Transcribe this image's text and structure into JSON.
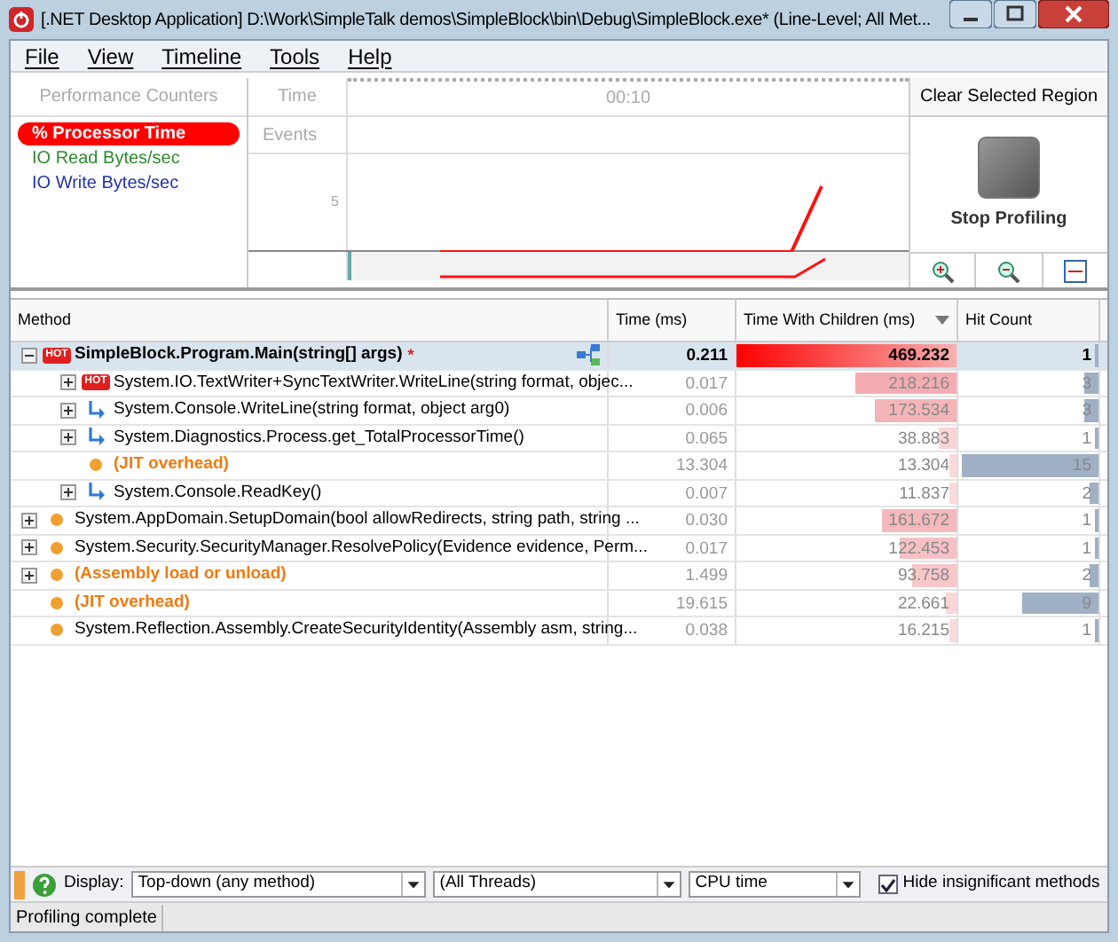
{
  "window": {
    "title": "[.NET Desktop Application] D:\\Work\\SimpleTalk demos\\SimpleBlock\\bin\\Debug\\SimpleBlock.exe* (Line-Level; All Met..."
  },
  "menu": [
    "File",
    "View",
    "Timeline",
    "Tools",
    "Help"
  ],
  "counters": {
    "title": "Performance Counters",
    "items": [
      {
        "label": "% Processor Time",
        "selected": true,
        "color": "#ff0000"
      },
      {
        "label": "IO Read Bytes/sec",
        "selected": false,
        "color": "#2e8b2e"
      },
      {
        "label": "IO Write Bytes/sec",
        "selected": false,
        "color": "#2233aa"
      }
    ]
  },
  "timeline": {
    "time_label": "Time",
    "time_tick": "00:10",
    "events_label": "Events",
    "axis_tick": "5"
  },
  "right_panel": {
    "clear_button": "Clear Selected Region",
    "stop_button": "Stop Profiling"
  },
  "table": {
    "columns": [
      {
        "label": "Method",
        "sorted": false
      },
      {
        "label": "Time (ms)",
        "sorted": false
      },
      {
        "label": "Time With Children (ms)",
        "sorted": true
      },
      {
        "label": "Hit Count",
        "sorted": false
      }
    ],
    "rows": [
      {
        "method": "SimpleBlock.Program.Main(string[] args)",
        "marker": "*",
        "kind": "hot",
        "hot_label": "HOT",
        "expanded": true,
        "selected": true,
        "bold": true,
        "special": false,
        "time": "0.211",
        "twc": {
          "text": "469.232",
          "level": 1
        },
        "hit": {
          "text": "1",
          "level": 0.02
        },
        "children": [
          {
            "method": "System.IO.TextWriter+SyncTextWriter.WriteLine(string format, objec...",
            "kind": "hot",
            "hot_label": "HOT",
            "expanded": false,
            "selected": false,
            "bold": false,
            "special": false,
            "time": "0.017",
            "twc": {
              "text": "218.216",
              "level": 0.46
            },
            "hit": {
              "text": "3",
              "level": 0.1
            }
          },
          {
            "method": "System.Console.WriteLine(string format, object arg0)",
            "kind": "call",
            "expanded": false,
            "selected": false,
            "bold": false,
            "special": false,
            "time": "0.006",
            "twc": {
              "text": "173.534",
              "level": 0.37
            },
            "hit": {
              "text": "3",
              "level": 0.1
            }
          },
          {
            "method": "System.Diagnostics.Process.get_TotalProcessorTime()",
            "kind": "call",
            "expanded": false,
            "selected": false,
            "bold": false,
            "special": false,
            "time": "0.065",
            "twc": {
              "text": "38.883",
              "level": 0.08
            },
            "hit": {
              "text": "1",
              "level": 0.02
            }
          },
          {
            "method": "(JIT overhead)",
            "kind": "dot",
            "selected": false,
            "bold": true,
            "special": true,
            "time": "13.304",
            "twc": {
              "text": "13.304",
              "level": 0.03
            },
            "hit": {
              "text": "15",
              "level": 0.97
            }
          },
          {
            "method": "System.Console.ReadKey()",
            "kind": "call",
            "expanded": false,
            "selected": false,
            "bold": false,
            "special": false,
            "time": "0.007",
            "twc": {
              "text": "11.837",
              "level": 0.03
            },
            "hit": {
              "text": "2",
              "level": 0.06
            }
          }
        ]
      },
      {
        "method": "System.AppDomain.SetupDomain(bool allowRedirects, string path, string ...",
        "kind": "dot",
        "expanded": false,
        "selected": false,
        "bold": false,
        "special": false,
        "time": "0.030",
        "twc": {
          "text": "161.672",
          "level": 0.34
        },
        "hit": {
          "text": "1",
          "level": 0.02
        }
      },
      {
        "method": "System.Security.SecurityManager.ResolvePolicy(Evidence evidence, Perm...",
        "kind": "dot",
        "expanded": false,
        "selected": false,
        "bold": false,
        "special": false,
        "time": "0.017",
        "twc": {
          "text": "122.453",
          "level": 0.26
        },
        "hit": {
          "text": "1",
          "level": 0.02
        }
      },
      {
        "method": "(Assembly load or unload)",
        "kind": "dot",
        "expanded": false,
        "selected": false,
        "bold": true,
        "special": true,
        "time": "1.499",
        "twc": {
          "text": "93.758",
          "level": 0.2
        },
        "hit": {
          "text": "2",
          "level": 0.06
        }
      },
      {
        "method": "(JIT overhead)",
        "kind": "dot",
        "selected": false,
        "bold": true,
        "special": true,
        "time": "19.615",
        "twc": {
          "text": "22.661",
          "level": 0.05
        },
        "hit": {
          "text": "9",
          "level": 0.55
        }
      },
      {
        "method": "System.Reflection.Assembly.CreateSecurityIdentity(Assembly asm, string...",
        "kind": "dot",
        "selected": false,
        "bold": false,
        "special": false,
        "time": "0.038",
        "twc": {
          "text": "16.215",
          "level": 0.03
        },
        "hit": {
          "text": "1",
          "level": 0.02
        }
      }
    ]
  },
  "toolbar": {
    "display_label": "Display:",
    "view": "Top-down (any method)",
    "threads": "(All Threads)",
    "metric": "CPU time",
    "hide_insignificant": {
      "label": "Hide insignificant methods",
      "checked": true
    }
  },
  "status_bar": "Profiling complete"
}
